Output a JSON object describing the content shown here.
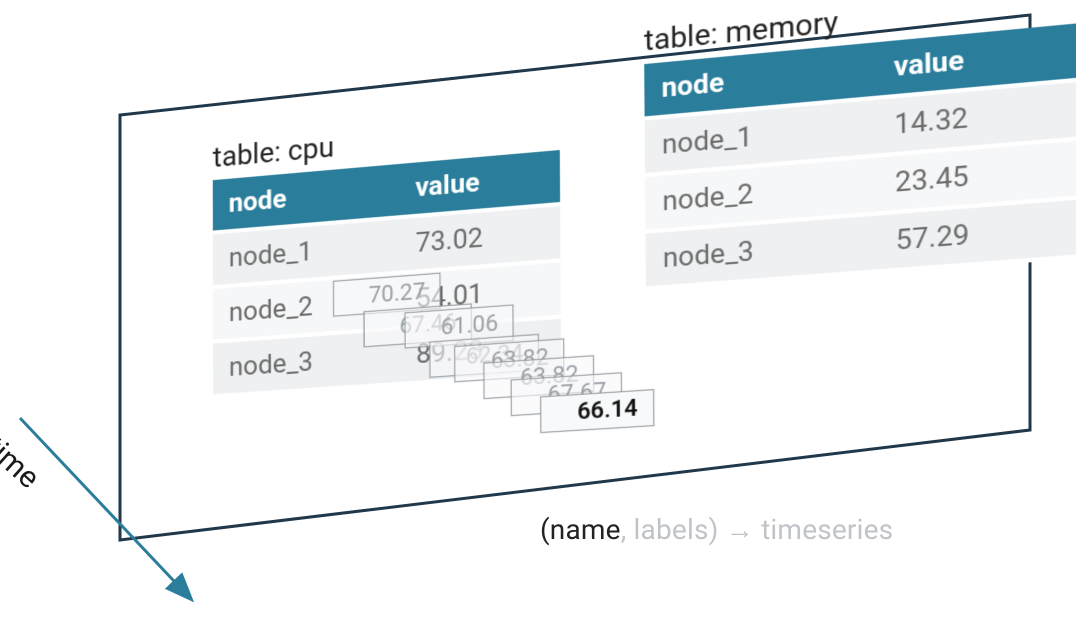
{
  "tables": {
    "cpu": {
      "title": "table: cpu",
      "headers": {
        "col0": "node",
        "col1": "value"
      },
      "rows": [
        {
          "node": "node_1",
          "value": "73.02"
        },
        {
          "node": "node_2",
          "value": "54.01"
        },
        {
          "node": "node_3",
          "value": "89.23"
        }
      ]
    },
    "memory": {
      "title": "table: memory",
      "headers": {
        "col0": "node",
        "col1": "value"
      },
      "rows": [
        {
          "node": "node_1",
          "value": "14.32"
        },
        {
          "node": "node_2",
          "value": "23.45"
        },
        {
          "node": "node_3",
          "value": "57.29"
        }
      ]
    }
  },
  "timeseries_cards": [
    "70.27",
    "67.46",
    "61.06",
    "62.34",
    "63.82",
    "63.82",
    "67.67",
    "66.14"
  ],
  "axis": {
    "time_label": "time"
  },
  "caption": {
    "p1": "(name",
    "p2": ", labels) ",
    "p3": "→",
    "p4": " timeseries"
  },
  "colors": {
    "header_bg": "#2a7e9b",
    "frame_stroke": "#20384a",
    "arrow_stroke": "#2a7e9b"
  }
}
